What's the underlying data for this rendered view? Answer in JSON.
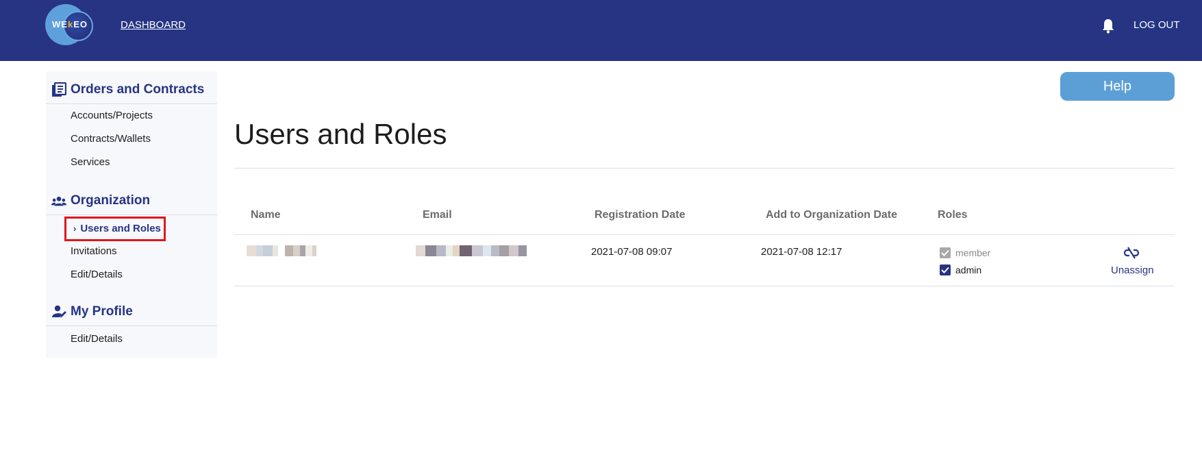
{
  "header": {
    "logo_text_a": "WE",
    "logo_text_k": "k",
    "logo_text_b": "EO",
    "dashboard_label": "DASHBOARD",
    "logout_label": "LOG OUT",
    "bell_icon": "bell-icon"
  },
  "sidebar": {
    "sections": [
      {
        "title": "Orders and Contracts",
        "icon": "book-icon",
        "items": [
          "Accounts/Projects",
          "Contracts/Wallets",
          "Services"
        ]
      },
      {
        "title": "Organization",
        "icon": "users-icon",
        "items": [
          "Users and Roles",
          "Invitations",
          "Edit/Details"
        ]
      },
      {
        "title": "My Profile",
        "icon": "user-edit-icon",
        "items": [
          "Edit/Details"
        ]
      }
    ],
    "active_item": "Users and Roles"
  },
  "main": {
    "help_label": "Help",
    "page_title": "Users and Roles",
    "table": {
      "columns": [
        "Name",
        "Email",
        "Registration Date",
        "Add to Organization Date",
        "Roles"
      ],
      "rows": [
        {
          "registration_date": "2021-07-08 09:07",
          "org_date": "2021-07-08 12:17",
          "roles": [
            {
              "label": "member",
              "checked": true,
              "disabled": true
            },
            {
              "label": "admin",
              "checked": true,
              "disabled": false
            }
          ],
          "unassign_label": "Unassign"
        }
      ]
    }
  },
  "colors": {
    "brand": "#263483",
    "help": "#5c9fd6",
    "highlight": "#e0161c"
  }
}
